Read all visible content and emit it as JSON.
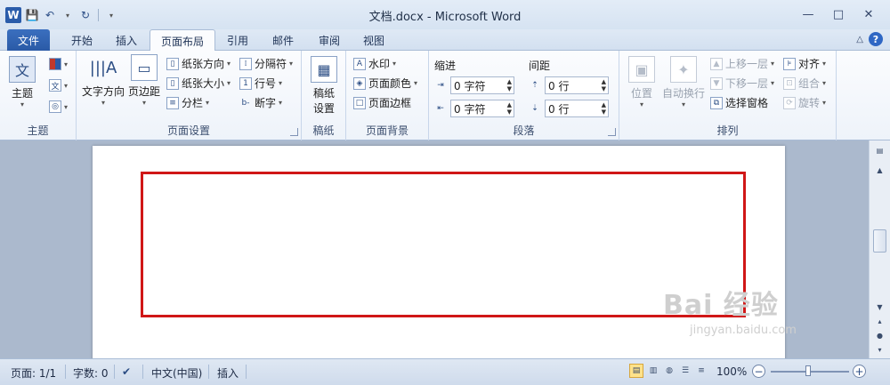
{
  "titlebar": {
    "title": "文档.docx - Microsoft Word",
    "logo_text": "W",
    "qat_items": [
      "save-icon",
      "undo-icon",
      "redo-icon",
      "customize-icon"
    ],
    "window_controls": [
      "minimize-icon",
      "restore-icon",
      "close-icon"
    ]
  },
  "tabs": [
    "文件",
    "开始",
    "插入",
    "页面布局",
    "引用",
    "邮件",
    "审阅",
    "视图"
  ],
  "active_tab": "页面布局",
  "ribbon": {
    "theme_group": {
      "label": "主题",
      "themes_btn": "主题"
    },
    "page_setup": {
      "label": "页面设置",
      "text_direction": "文字方向",
      "margins": "页边距",
      "orientation": "纸张方向",
      "size": "纸张大小",
      "columns": "分栏",
      "breaks": "分隔符",
      "line_numbers": "行号",
      "hyphenation": "断字"
    },
    "manuscript": {
      "label": "稿纸",
      "btn_line1": "稿纸",
      "btn_line2": "设置"
    },
    "page_background": {
      "label": "页面背景",
      "watermark": "水印",
      "page_color": "页面颜色",
      "page_borders": "页面边框"
    },
    "paragraph": {
      "label": "段落",
      "indent_title": "缩进",
      "spacing_title": "间距",
      "indent_left": "0 字符",
      "indent_right": "0 字符",
      "spacing_before": "0 行",
      "spacing_after": "0 行"
    },
    "arrange": {
      "label": "排列",
      "position": "位置",
      "wrap_text": "自动换行",
      "bring_forward": "上移一层",
      "send_backward": "下移一层",
      "selection_pane": "选择窗格",
      "align": "对齐",
      "group": "组合",
      "rotate": "旋转"
    }
  },
  "statusbar": {
    "page": "页面: 1/1",
    "words": "字数: 0",
    "language": "中文(中国)",
    "insert_mode": "插入",
    "zoom": "100%"
  },
  "watermark": {
    "main": "Bai 经验",
    "sub": "jingyan.baidu.com"
  },
  "colors": {
    "highlight_border": "#d01717",
    "file_tab": "#2a5aa6",
    "doc_background": "#abb9cd"
  }
}
